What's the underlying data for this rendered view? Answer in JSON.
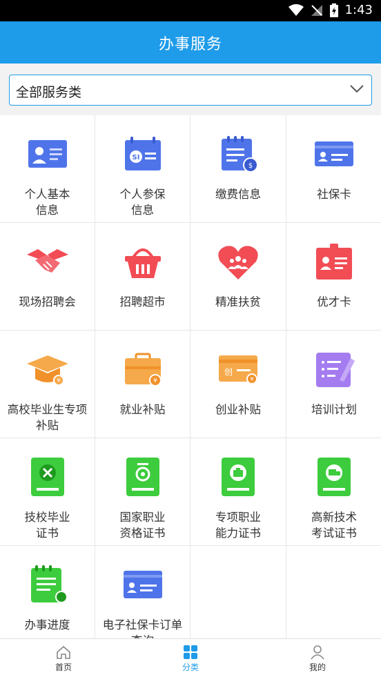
{
  "status": {
    "time": "1:43"
  },
  "header": {
    "title": "办事服务"
  },
  "filter": {
    "selected": "全部服务类"
  },
  "services": [
    {
      "label": "个人基本\n信息",
      "icon": "id-card-icon"
    },
    {
      "label": "个人参保\n信息",
      "icon": "insurance-calendar-icon"
    },
    {
      "label": "缴费信息",
      "icon": "payment-doc-icon"
    },
    {
      "label": "社保卡",
      "icon": "social-card-icon"
    },
    {
      "label": "现场招聘会",
      "icon": "handshake-icon"
    },
    {
      "label": "招聘超市",
      "icon": "basket-icon"
    },
    {
      "label": "精准扶贫",
      "icon": "heart-people-icon"
    },
    {
      "label": "优才卡",
      "icon": "talent-card-icon"
    },
    {
      "label": "高校毕业生专项\n补贴",
      "icon": "graduation-cap-icon"
    },
    {
      "label": "就业补贴",
      "icon": "briefcase-icon"
    },
    {
      "label": "创业补贴",
      "icon": "startup-card-icon"
    },
    {
      "label": "培训计划",
      "icon": "training-plan-icon"
    },
    {
      "label": "技校毕业\n证书",
      "icon": "tools-certificate-icon"
    },
    {
      "label": "国家职业\n资格证书",
      "icon": "medal-certificate-icon"
    },
    {
      "label": "专项职业\n能力证书",
      "icon": "bag-certificate-icon"
    },
    {
      "label": "高新技术\n考试证书",
      "icon": "truck-certificate-icon"
    },
    {
      "label": "办事进度",
      "icon": "progress-clipboard-icon"
    },
    {
      "label": "电子社保卡订单\n查询",
      "icon": "e-social-card-icon"
    }
  ],
  "tabs": [
    {
      "label": "首页",
      "icon": "home-icon"
    },
    {
      "label": "分类",
      "icon": "category-icon"
    },
    {
      "label": "我的",
      "icon": "user-icon"
    }
  ],
  "colors": {
    "accent": "#1e9be9",
    "blue": "#4f74ea",
    "red": "#f24c55",
    "orange": "#f5a94a",
    "green": "#3dcc3d",
    "purple": "#a47cf0"
  }
}
